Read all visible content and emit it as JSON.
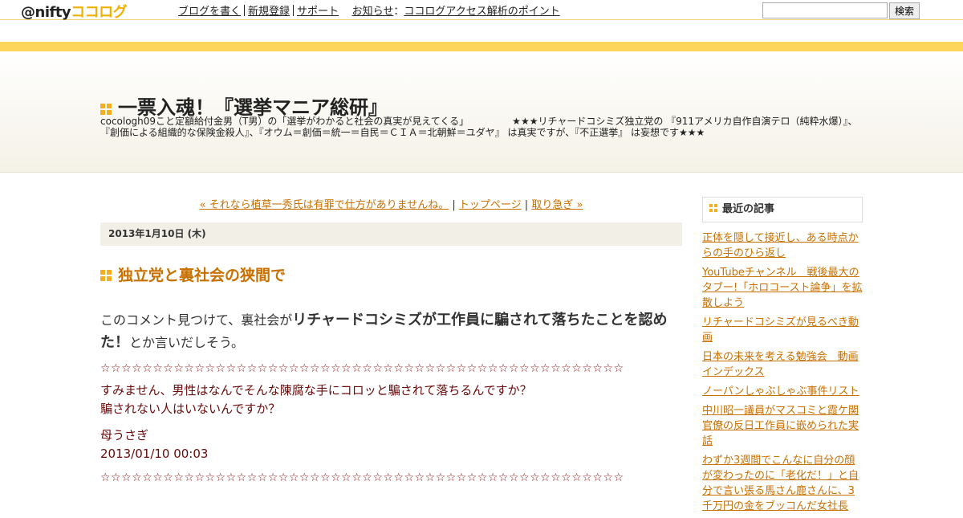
{
  "topbar": {
    "logo_at": "@nifty",
    "logo_coco": "ココログ",
    "nav": [
      "ブログを書く",
      "新規登録",
      "サポート"
    ],
    "notice_label": "お知らせ",
    "notice_colon": "：",
    "notice_link": "ココログアクセス解析のポイント",
    "search_value": "",
    "search_button": "検索"
  },
  "header": {
    "title": "一票入魂！『選挙マニア総研』",
    "description": "cocologh09こと定額給付金男（T男）の「選挙がわかると社会の真実が見えてくる」　　　　　★★★リチャードコシミズ独立党の 『911アメリカ自作自演テロ（純粋水爆）』、『創価による組織的な保険金殺人』、『オウム＝創価＝統一＝自民＝ＣＩＡ＝北朝鮮＝ユダヤ』 は真実ですが、『不正選挙』 は妄想です★★★"
  },
  "post_nav": {
    "prev": "« それなら植草一秀氏は有罪で仕方がありませんね。",
    "sep1": " | ",
    "top": "トップページ",
    "sep2": " | ",
    "next": "取り急ぎ »"
  },
  "post": {
    "date": "2013年1月10日 (木)",
    "title": "独立党と裏社会の狭間で",
    "body_pre": "このコメント見つけて、裏社会が",
    "body_bold": "リチャードコシミズが工作員に騙されて落ちたことを認めた！",
    "body_post": "とか言いだしそう。",
    "stars": "☆☆☆☆☆☆☆☆☆☆☆☆☆☆☆☆☆☆☆☆☆☆☆☆☆☆☆☆☆☆☆☆☆☆☆☆☆☆☆☆☆☆☆☆☆☆☆☆☆☆",
    "quote_line1": "すみません、男性はなんでそんな陳腐な手にコロッと騙されて落ちるんですか？",
    "quote_line2": "騙されない人はいないんですか？",
    "author": "母うさぎ",
    "timestamp": "2013/01/10 00:03"
  },
  "sidebar": {
    "heading": "最近の記事",
    "items": [
      "正体を隠して接近し、ある時点からの手のひら返し",
      "YouTubeチャンネル　戦後最大のタブー!「ホロコースト論争」を拡散しよう",
      "リチャードコシミズが見るべき動画",
      "日本の未来を考える勉強会　動画インデックス",
      "ノーパンしゃぶしゃぶ事件リスト",
      "中川昭一議員がマスコミと霞ケ関官僚の反日工作員に嵌められた実話",
      "わずか3週間でこんなに自分の顔が変わったのに「老化だ！」と自分で言い張る馬さん鹿さんに、3千万円の金をブッコんだ女社長"
    ]
  },
  "colors": {
    "accent": "#c87000",
    "band": "#fcd55a",
    "square": "#f0b020",
    "quote": "#6a0a0a"
  }
}
